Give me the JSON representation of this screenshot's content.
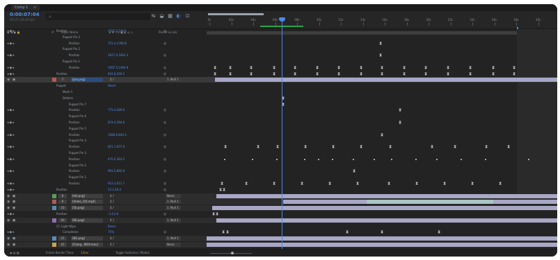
{
  "tab": {
    "label": "Comp 1",
    "close": "≡"
  },
  "header": {
    "timecode": "0:00:07:04",
    "fps": "00172 (24.00 fps)",
    "search_icon": "search-icon",
    "tools": [
      "draft-3d-icon",
      "shy-layers-icon",
      "frame-blending-icon",
      "motion-blur-icon",
      "graph-editor-icon"
    ]
  },
  "columns": {
    "switches": "◉ ◑ ● 🔒",
    "label": "#",
    "layer_name": "Layer Name",
    "props": "★ ✥ \\ fx ▣ ◐ ◎ ○",
    "parent": "Parent & Link"
  },
  "ruler": {
    "labels": [
      "0s",
      "02s",
      "04s",
      "06s",
      "08s",
      "10s",
      "12s",
      "14s",
      "16s",
      "18s",
      "20s",
      "22s",
      "24s",
      "26s",
      "28s",
      "30s"
    ]
  },
  "rows": [
    {
      "type": "prop",
      "name": "Position",
      "val": "1507.7,744.6",
      "ic": "◎",
      "indent": 1,
      "kf": []
    },
    {
      "type": "group",
      "name": "Puppet Pin 2",
      "indent": 2
    },
    {
      "type": "prop",
      "name": "Position",
      "val": "751.4,1780.8",
      "ic": "◎",
      "indent": 3
    },
    {
      "type": "group",
      "name": "Puppet Pin 2",
      "indent": 2
    },
    {
      "type": "prop",
      "name": "Position",
      "val": "1817.0,1893.3",
      "ic": "◎",
      "indent": 3
    },
    {
      "type": "group",
      "name": "Puppet Pin 1",
      "indent": 2
    },
    {
      "type": "prop",
      "name": "Position",
      "val": "1097.5,1495.8",
      "ic": "◎",
      "indent": 3
    },
    {
      "type": "prop",
      "name": "Position",
      "val": "641.8,290.5",
      "ic": "◎",
      "indent": 1
    },
    {
      "type": "layer",
      "num": "7",
      "name": "[pro.png]",
      "mode": "‡ /",
      "parent": "1. Null 1",
      "sel": true
    },
    {
      "type": "group",
      "name": "Puppet",
      "val": "Reset",
      "indent": 1
    },
    {
      "type": "group",
      "name": "Mesh 1",
      "indent": 2
    },
    {
      "type": "group",
      "name": "Deform",
      "indent": 2
    },
    {
      "type": "group",
      "name": "Puppet Pin 7",
      "indent": 3
    },
    {
      "type": "prop",
      "name": "Position",
      "val": "775.4,589.6",
      "ic": "◎",
      "indent": 3
    },
    {
      "type": "group",
      "name": "Puppet Pin 6",
      "indent": 3
    },
    {
      "type": "prop",
      "name": "Position",
      "val": "874.4,394.6",
      "ic": "◎",
      "indent": 3
    },
    {
      "type": "group",
      "name": "Puppet Pin 5",
      "indent": 3
    },
    {
      "type": "prop",
      "name": "Position",
      "val": "1080.6,844.3",
      "ic": "◎",
      "indent": 3
    },
    {
      "type": "group",
      "name": "Puppet Pin 4",
      "indent": 3
    },
    {
      "type": "prop",
      "name": "Position",
      "val": "821.1,657.6",
      "ic": "◎",
      "indent": 3
    },
    {
      "type": "group",
      "name": "Puppet Pin 3",
      "indent": 3
    },
    {
      "type": "prop",
      "name": "Position",
      "val": "470.0,363.2",
      "ic": "◎",
      "indent": 3
    },
    {
      "type": "group",
      "name": "Puppet Pin 2",
      "indent": 3
    },
    {
      "type": "prop",
      "name": "Position",
      "val": "993.5,895.8",
      "ic": "◎",
      "indent": 3
    },
    {
      "type": "group",
      "name": "Puppet Pin 1",
      "indent": 3
    },
    {
      "type": "prop",
      "name": "Position",
      "val": "953.3,611.7",
      "ic": "◎",
      "indent": 3
    },
    {
      "type": "prop",
      "name": "Position",
      "val": "53.2,59.0",
      "ic": "◎",
      "indent": 1
    },
    {
      "type": "layer",
      "num": "8",
      "name": "[hill.png]",
      "mode": "‡ /",
      "parent": "None"
    },
    {
      "type": "layer",
      "num": "9",
      "name": "[Video_10].mp4]",
      "mode": "‡ /",
      "parent": "1. Null 1"
    },
    {
      "type": "layer",
      "num": "10",
      "name": "[5b.png]",
      "mode": "‡ /",
      "parent": "1. Null 1"
    },
    {
      "type": "prop",
      "name": "Position",
      "val": "-3.4,0.6",
      "ic": "◎",
      "indent": 1
    },
    {
      "type": "layer",
      "num": "20",
      "name": "[6E.png]",
      "mode": "‡ /",
      "parent": "1. Null 1"
    },
    {
      "type": "group",
      "name": "CC Light Wipe",
      "val": "Reset",
      "indent": 1
    },
    {
      "type": "prop",
      "name": "Completion",
      "val": "75%",
      "ic": "◎",
      "indent": 2
    },
    {
      "type": "layer",
      "num": "21",
      "name": "[8G.png]",
      "mode": "‡ /",
      "parent": "1. Null 1"
    },
    {
      "type": "layer",
      "num": "22",
      "name": "[Clang...MOV.mov]",
      "mode": "‡ /",
      "parent": "None"
    }
  ],
  "footer": {
    "label": "Frame Render Time:",
    "time": "13ms",
    "toggle": "Toggle Switches / Modes"
  }
}
